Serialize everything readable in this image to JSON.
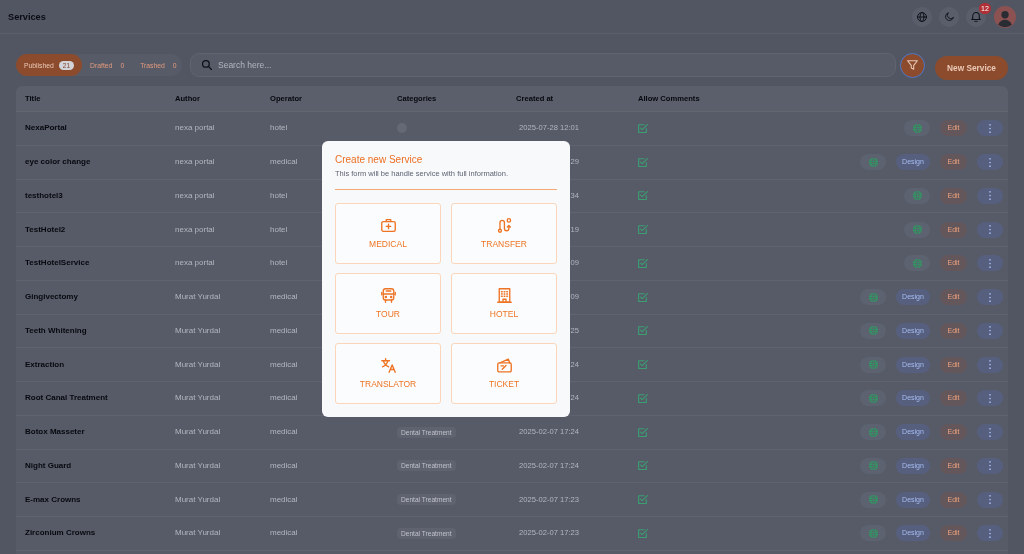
{
  "top_bar": {
    "title": "Services",
    "notification_count": "12"
  },
  "tabs": [
    {
      "label": "Published",
      "count": "21",
      "selected": true
    },
    {
      "label": "Drafted",
      "count": "0",
      "selected": false
    },
    {
      "label": "Trashed",
      "count": "0",
      "selected": false
    }
  ],
  "search": {
    "placeholder": "Search here..."
  },
  "filter_button": {
    "focused": true
  },
  "new_button": {
    "label": "New Service"
  },
  "table": {
    "columns": [
      "Title",
      "Author",
      "Operator",
      "Categories",
      "Created at",
      "Allow Comments"
    ],
    "rows": [
      {
        "title": "NexaPortal",
        "author": "nexa portal",
        "operator": "hotel",
        "category": {
          "kind": "empty"
        },
        "created_at": "2025-07-28 12:01",
        "allow_comments": true,
        "actions": [
          {
            "kind": "globe"
          },
          {
            "kind": "edit",
            "label": "Edit"
          },
          {
            "kind": "more"
          }
        ]
      },
      {
        "title": "eye color change",
        "author": "nexa portal",
        "operator": "medical",
        "created_at": "29",
        "allow_comments": true,
        "actions": [
          {
            "kind": "globe"
          },
          {
            "kind": "design",
            "label": "Design"
          },
          {
            "kind": "edit",
            "label": "Edit"
          },
          {
            "kind": "more"
          }
        ]
      },
      {
        "title": "testhotel3",
        "author": "nexa portal",
        "operator": "hotel",
        "created_at": "34",
        "allow_comments": true,
        "actions": [
          {
            "kind": "globe"
          },
          {
            "kind": "edit",
            "label": "Edit"
          },
          {
            "kind": "more"
          }
        ]
      },
      {
        "title": "TestHotel2",
        "author": "nexa portal",
        "operator": "hotel",
        "created_at": "19",
        "allow_comments": true,
        "actions": [
          {
            "kind": "globe"
          },
          {
            "kind": "edit",
            "label": "Edit"
          },
          {
            "kind": "more"
          }
        ]
      },
      {
        "title": "TestHotelService",
        "author": "nexa portal",
        "operator": "hotel",
        "created_at": "09",
        "allow_comments": true,
        "actions": [
          {
            "kind": "globe"
          },
          {
            "kind": "edit",
            "label": "Edit"
          },
          {
            "kind": "more"
          }
        ]
      },
      {
        "title": "Gingivectomy",
        "author": "Murat Yurdal",
        "operator": "medical",
        "created_at": "09",
        "allow_comments": true,
        "actions": [
          {
            "kind": "globe"
          },
          {
            "kind": "design",
            "label": "Design"
          },
          {
            "kind": "edit",
            "label": "Edit"
          },
          {
            "kind": "more"
          }
        ]
      },
      {
        "title": "Teeth Whitening",
        "author": "Murat Yurdal",
        "operator": "medical",
        "created_at": "25",
        "allow_comments": true,
        "actions": [
          {
            "kind": "globe"
          },
          {
            "kind": "design",
            "label": "Design"
          },
          {
            "kind": "edit",
            "label": "Edit"
          },
          {
            "kind": "more"
          }
        ]
      },
      {
        "title": "Extraction",
        "author": "Murat Yurdal",
        "operator": "medical",
        "created_at": "24",
        "allow_comments": true,
        "actions": [
          {
            "kind": "globe"
          },
          {
            "kind": "design",
            "label": "Design"
          },
          {
            "kind": "edit",
            "label": "Edit"
          },
          {
            "kind": "more"
          }
        ]
      },
      {
        "title": "Root Canal Treatment",
        "author": "Murat Yurdal",
        "operator": "medical",
        "created_at": "24",
        "allow_comments": true,
        "actions": [
          {
            "kind": "globe"
          },
          {
            "kind": "design",
            "label": "Design"
          },
          {
            "kind": "edit",
            "label": "Edit"
          },
          {
            "kind": "more"
          }
        ]
      },
      {
        "title": "Botox Masseter",
        "author": "Murat Yurdal",
        "operator": "medical",
        "category": {
          "kind": "tag",
          "label": "Dental Treatment"
        },
        "created_at": "2025-02-07 17:24",
        "allow_comments": true,
        "actions": [
          {
            "kind": "globe"
          },
          {
            "kind": "design",
            "label": "Design"
          },
          {
            "kind": "edit",
            "label": "Edit"
          },
          {
            "kind": "more"
          }
        ]
      },
      {
        "title": "Night Guard",
        "author": "Murat Yurdal",
        "operator": "medical",
        "category": {
          "kind": "tag",
          "label": "Dental Treatment"
        },
        "created_at": "2025-02-07 17:24",
        "allow_comments": true,
        "actions": [
          {
            "kind": "globe"
          },
          {
            "kind": "design",
            "label": "Design"
          },
          {
            "kind": "edit",
            "label": "Edit"
          },
          {
            "kind": "more"
          }
        ]
      },
      {
        "title": "E-max Crowns",
        "author": "Murat Yurdal",
        "operator": "medical",
        "category": {
          "kind": "tag",
          "label": "Dental Treatment"
        },
        "created_at": "2025-02-07 17:23",
        "allow_comments": true,
        "actions": [
          {
            "kind": "globe"
          },
          {
            "kind": "design",
            "label": "Design"
          },
          {
            "kind": "edit",
            "label": "Edit"
          },
          {
            "kind": "more"
          }
        ]
      },
      {
        "title": "Zirconium Crowns",
        "author": "Murat Yurdal",
        "operator": "medical",
        "category": {
          "kind": "tag",
          "label": "Dental Treatment"
        },
        "created_at": "2025-02-07 17:23",
        "allow_comments": true,
        "actions": [
          {
            "kind": "globe"
          },
          {
            "kind": "design",
            "label": "Design"
          },
          {
            "kind": "edit",
            "label": "Edit"
          },
          {
            "kind": "more"
          }
        ]
      }
    ]
  },
  "modal": {
    "title": "Create new Service",
    "subtitle": "This form will be handle service with full information.",
    "options": [
      {
        "kind": "medical",
        "label": "MEDICAL"
      },
      {
        "kind": "transfer",
        "label": "TRANSFER"
      },
      {
        "kind": "tour",
        "label": "TOUR"
      },
      {
        "kind": "hotel",
        "label": "HOTEL"
      },
      {
        "kind": "translator",
        "label": "TRANSLATOR"
      },
      {
        "kind": "ticket",
        "label": "TICKET"
      }
    ]
  }
}
